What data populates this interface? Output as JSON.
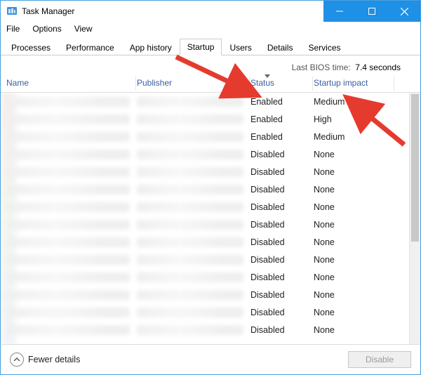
{
  "window": {
    "title": "Task Manager"
  },
  "menu": {
    "file": "File",
    "options": "Options",
    "view": "View"
  },
  "tabs": {
    "processes": "Processes",
    "performance": "Performance",
    "app_history": "App history",
    "startup": "Startup",
    "users": "Users",
    "details": "Details",
    "services": "Services"
  },
  "bios": {
    "label": "Last BIOS time:",
    "value": "7.4 seconds"
  },
  "columns": {
    "name": "Name",
    "publisher": "Publisher",
    "status": "Status",
    "startup_impact": "Startup impact"
  },
  "rows": [
    {
      "status": "Enabled",
      "impact": "Medium"
    },
    {
      "status": "Enabled",
      "impact": "High"
    },
    {
      "status": "Enabled",
      "impact": "Medium"
    },
    {
      "status": "Disabled",
      "impact": "None"
    },
    {
      "status": "Disabled",
      "impact": "None"
    },
    {
      "status": "Disabled",
      "impact": "None"
    },
    {
      "status": "Disabled",
      "impact": "None"
    },
    {
      "status": "Disabled",
      "impact": "None"
    },
    {
      "status": "Disabled",
      "impact": "None"
    },
    {
      "status": "Disabled",
      "impact": "None"
    },
    {
      "status": "Disabled",
      "impact": "None"
    },
    {
      "status": "Disabled",
      "impact": "None"
    },
    {
      "status": "Disabled",
      "impact": "None"
    },
    {
      "status": "Disabled",
      "impact": "None"
    }
  ],
  "footer": {
    "fewer": "Fewer details",
    "disable": "Disable"
  }
}
